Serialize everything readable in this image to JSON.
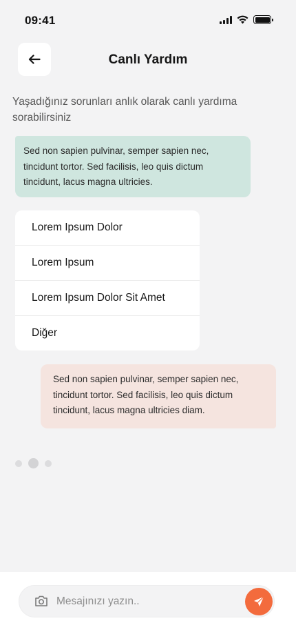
{
  "status_bar": {
    "time": "09:41"
  },
  "header": {
    "title": "Canlı Yardım",
    "back_icon": "arrow-left-icon"
  },
  "intro_text": "Yaşadığınız sorunları anlık olarak canlı yardıma sorabilirsiniz",
  "messages": {
    "incoming": "Sed non sapien pulvinar, semper sapien nec, tincidunt tortor. Sed facilisis, leo quis dictum tincidunt, lacus magna ultricies.",
    "outgoing": "Sed non sapien pulvinar, semper sapien nec, tincidunt tortor. Sed facilisis, leo quis dictum tincidunt, lacus magna ultricies diam."
  },
  "options": [
    {
      "label": "Lorem Ipsum Dolor"
    },
    {
      "label": "Lorem Ipsum"
    },
    {
      "label": "Lorem Ipsum Dolor Sit Amet"
    },
    {
      "label": "Diğer"
    }
  ],
  "composer": {
    "placeholder": "Mesajınızı yazın..",
    "camera_icon": "camera-icon",
    "send_icon": "send-icon"
  },
  "colors": {
    "incoming_bubble": "#cfe6df",
    "outgoing_bubble": "#f5e4df",
    "accent": "#f36b3d"
  }
}
